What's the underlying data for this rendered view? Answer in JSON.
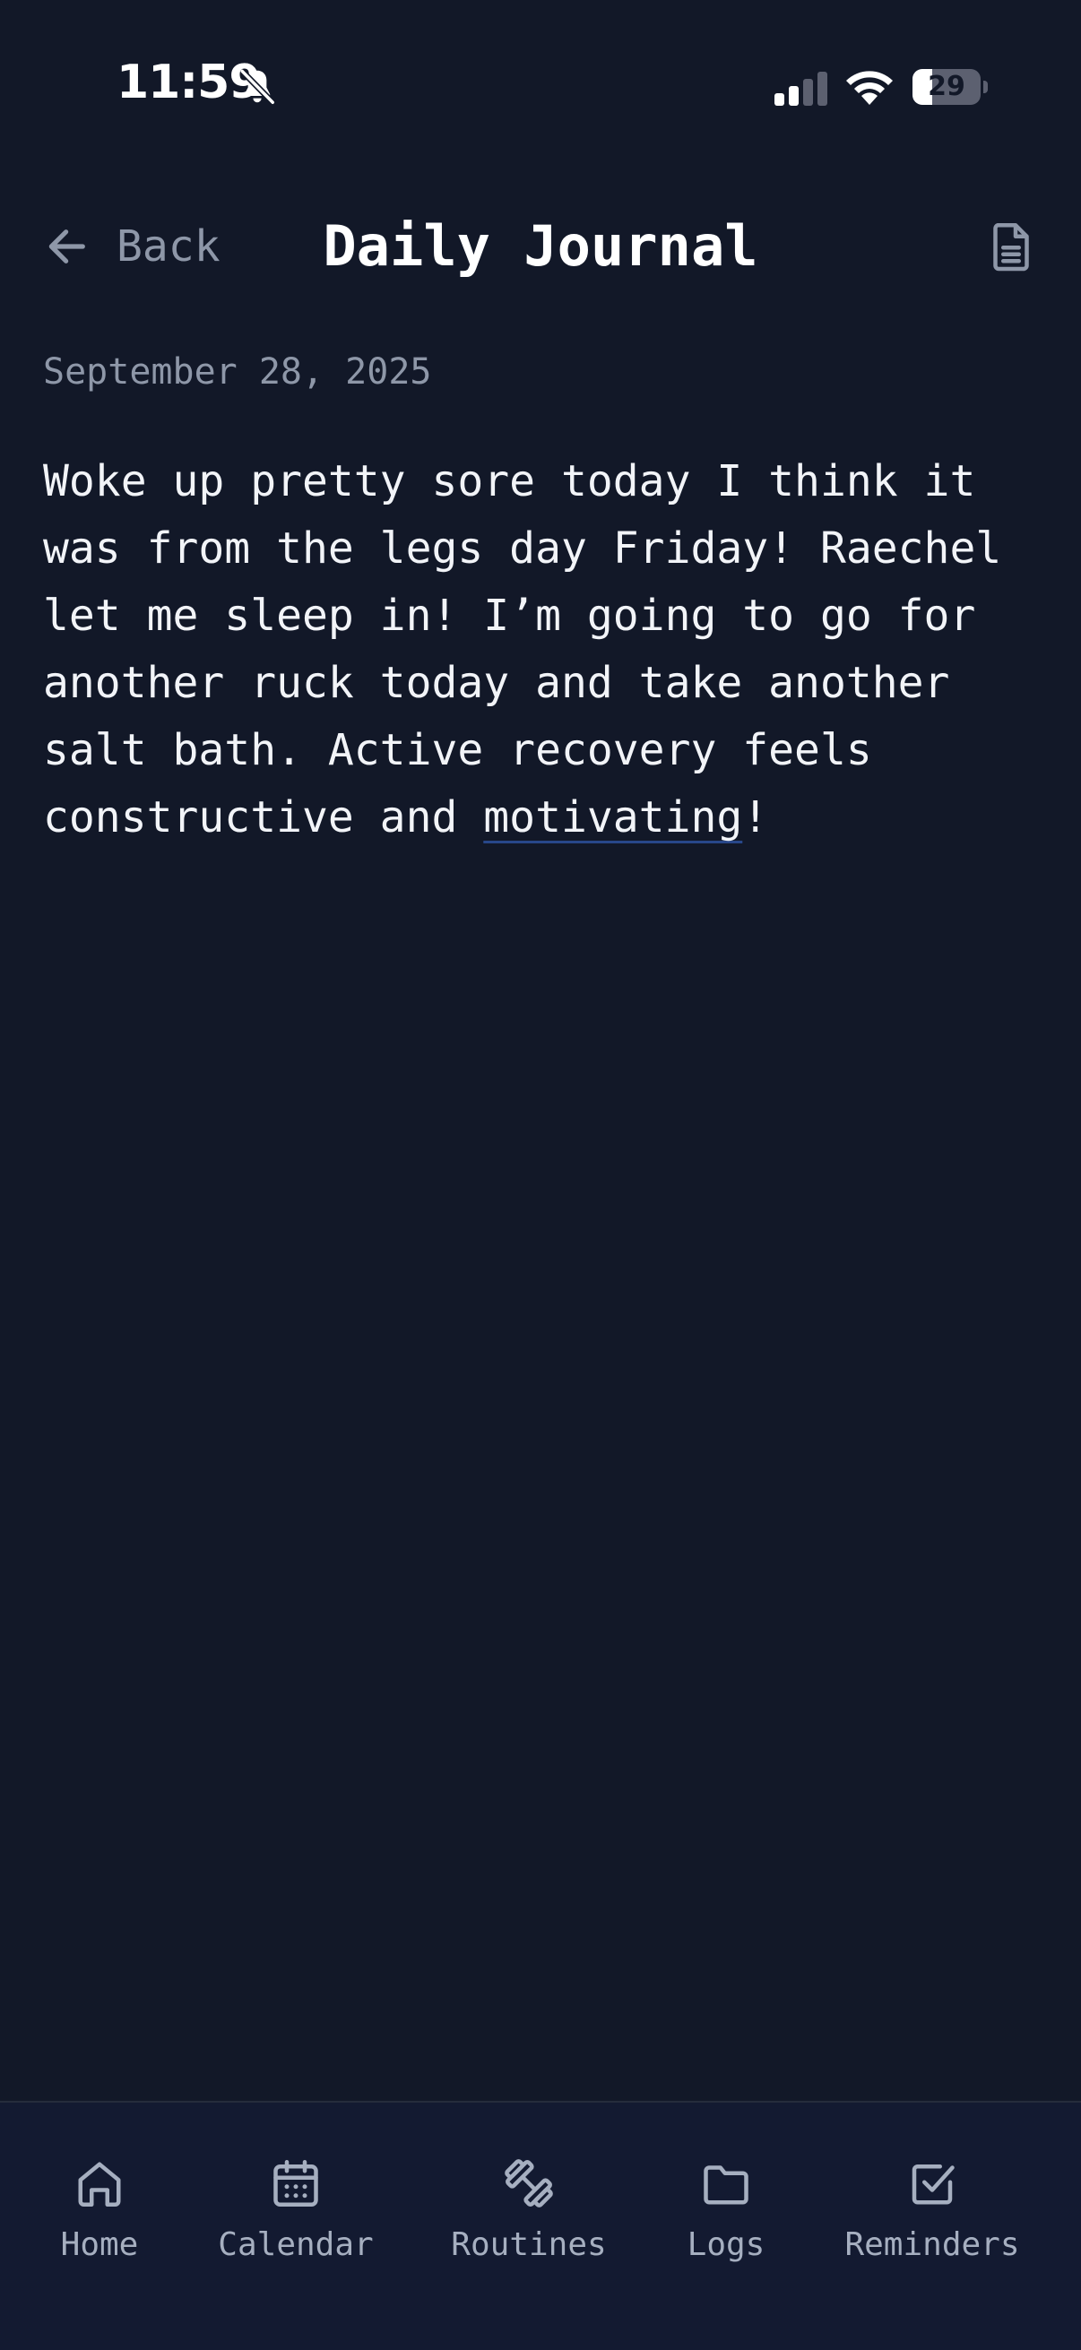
{
  "status_bar": {
    "time": "11:59",
    "battery_level": "29",
    "battery_percent": 29
  },
  "header": {
    "back_label": "Back",
    "title": "Daily Journal",
    "action_icon": "document-icon"
  },
  "entry": {
    "date": "September 28, 2025",
    "text_before": "Woke up pretty sore today I think it was from the legs day Friday! Raechel let me sleep in! I’m going to go for another ruck today and take another salt bath. Active recovery feels constructive and ",
    "text_underlined": "motivating",
    "text_after": "!"
  },
  "tabs": [
    {
      "label": "Home",
      "icon": "home-icon"
    },
    {
      "label": "Calendar",
      "icon": "calendar-icon"
    },
    {
      "label": "Routines",
      "icon": "dumbbell-icon"
    },
    {
      "label": "Logs",
      "icon": "folder-icon"
    },
    {
      "label": "Reminders",
      "icon": "checkbox-icon"
    }
  ],
  "colors": {
    "background": "#121828",
    "tab_bar_background": "#131a31",
    "muted_text": "#8e97a8",
    "tab_text": "#a6afc0",
    "primary_text": "#ffffff",
    "underline_accent": "#28478a"
  }
}
